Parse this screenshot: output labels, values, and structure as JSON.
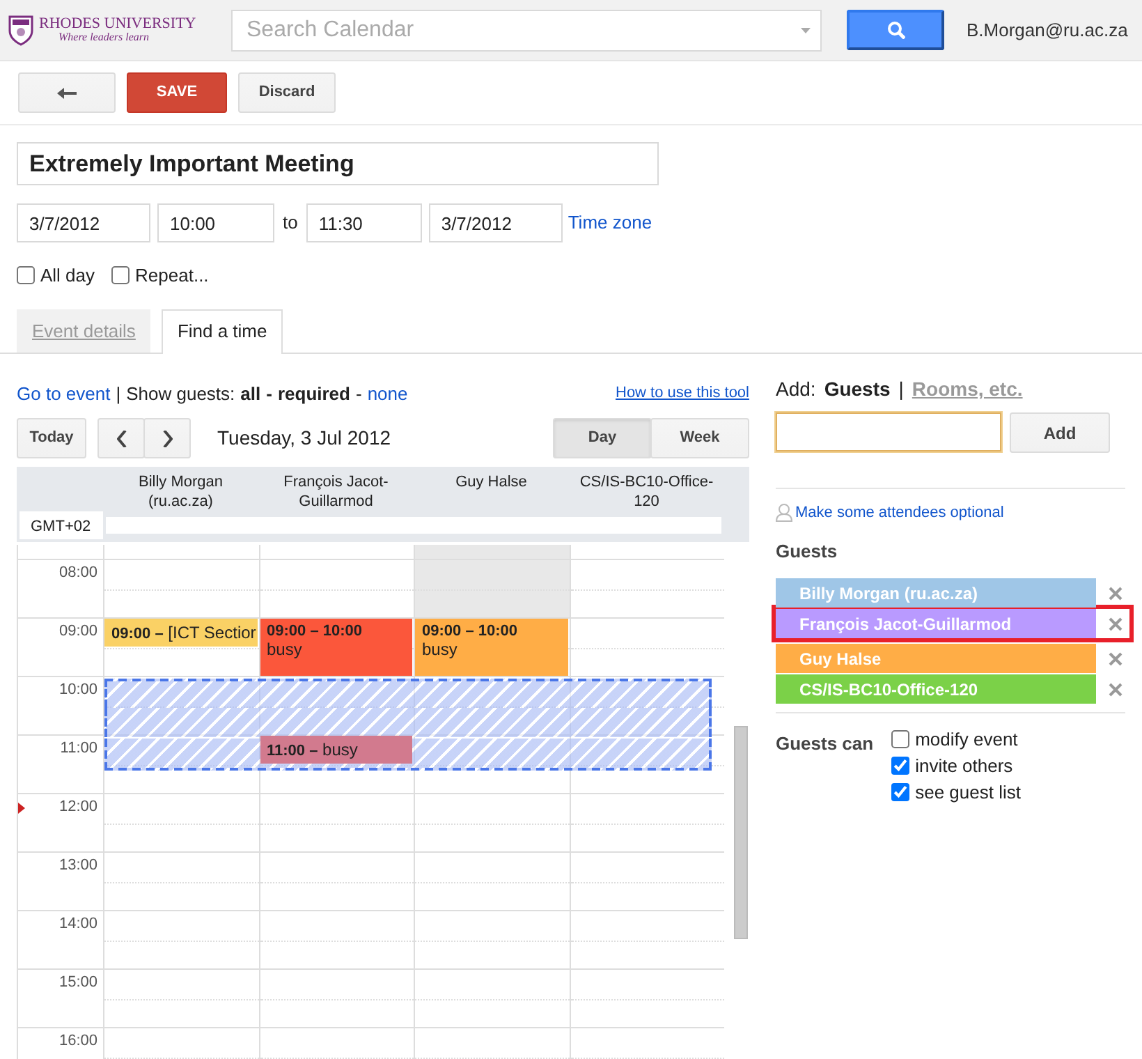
{
  "header": {
    "logo": {
      "name": "RHODES UNIVERSITY",
      "tagline": "Where leaders learn"
    },
    "search": {
      "placeholder": "Search Calendar"
    },
    "user": "B.Morgan@ru.ac.za"
  },
  "toolbar": {
    "save": "SAVE",
    "discard": "Discard"
  },
  "event": {
    "title": "Extremely Important Meeting",
    "start_date": "3/7/2012",
    "start_time": "10:00",
    "to": "to",
    "end_time": "11:30",
    "end_date": "3/7/2012",
    "time_zone": "Time zone"
  },
  "options": [
    {
      "label": "All day",
      "checked": false
    },
    {
      "label": "Repeat...",
      "checked": false
    }
  ],
  "tabs": [
    {
      "label": "Event details",
      "selected": false
    },
    {
      "label": "Find a time",
      "selected": true
    }
  ],
  "find_time": {
    "go_to_event": "Go to event",
    "separator": "|",
    "show_guests_label": "Show guests:",
    "filter_separator": "-",
    "filters": [
      {
        "label": "all",
        "selected": true
      },
      {
        "label": "required",
        "selected": true
      },
      {
        "label": "none",
        "selected": false
      }
    ],
    "help_link": "How to use this tool",
    "today": "Today",
    "date": "Tuesday, 3 Jul 2012",
    "views": [
      {
        "label": "Day",
        "selected": true
      },
      {
        "label": "Week",
        "selected": false
      }
    ],
    "timezone": "GMT+02",
    "columns": [
      "Billy Morgan (ru.ac.za)",
      "François Jacot-Guillarmod",
      "Guy Halse",
      "CS/IS-BC10-Office-120"
    ],
    "hours": [
      {
        "kind": "partial",
        "now": false,
        "halves": [
          {
            "selected": false
          }
        ],
        "cells": [
          {
            "kind": "free"
          },
          {
            "kind": "free"
          },
          {
            "kind": "shaded"
          },
          {
            "kind": "free"
          }
        ]
      },
      {
        "kind": "hour",
        "label": "08:00",
        "now": false,
        "halves": [
          {
            "selected": false
          },
          {
            "selected": false
          }
        ],
        "cells": [
          {
            "kind": "free"
          },
          {
            "kind": "free"
          },
          {
            "kind": "shaded"
          },
          {
            "kind": "free"
          }
        ]
      },
      {
        "kind": "hour",
        "label": "09:00",
        "now": false,
        "halves": [
          {
            "selected": false
          },
          {
            "selected": false
          }
        ],
        "cells": [
          {
            "kind": "brief",
            "color": "#fad165",
            "time": "09:00 –",
            "text": "[ICT Sectior"
          },
          {
            "kind": "block",
            "color": "#fb573b",
            "time": "09:00 – 10:00",
            "text": "busy"
          },
          {
            "kind": "block",
            "color": "#ffad46",
            "time": "09:00 – 10:00",
            "text": "busy"
          },
          {
            "kind": "free"
          }
        ]
      },
      {
        "kind": "hour",
        "label": "10:00",
        "now": false,
        "halves": [
          {
            "selected": true
          },
          {
            "selected": true
          }
        ],
        "cells": [
          {
            "kind": "free"
          },
          {
            "kind": "free"
          },
          {
            "kind": "free"
          },
          {
            "kind": "free"
          }
        ]
      },
      {
        "kind": "hour",
        "label": "11:00",
        "now": false,
        "halves": [
          {
            "selected": true
          },
          {
            "selected": false
          }
        ],
        "cells": [
          {
            "kind": "free"
          },
          {
            "kind": "brief",
            "color": "#d27a8e",
            "time": "11:00 –",
            "text": "busy"
          },
          {
            "kind": "free"
          },
          {
            "kind": "free"
          }
        ]
      },
      {
        "kind": "hour",
        "label": "12:00",
        "now": true,
        "halves": [
          {
            "selected": false
          },
          {
            "selected": false
          }
        ],
        "cells": [
          {
            "kind": "free"
          },
          {
            "kind": "free"
          },
          {
            "kind": "free"
          },
          {
            "kind": "free"
          }
        ]
      },
      {
        "kind": "hour",
        "label": "13:00",
        "now": false,
        "halves": [
          {
            "selected": false
          },
          {
            "selected": false
          }
        ],
        "cells": [
          {
            "kind": "free"
          },
          {
            "kind": "free"
          },
          {
            "kind": "free"
          },
          {
            "kind": "free"
          }
        ]
      },
      {
        "kind": "hour",
        "label": "14:00",
        "now": false,
        "halves": [
          {
            "selected": false
          },
          {
            "selected": false
          }
        ],
        "cells": [
          {
            "kind": "free"
          },
          {
            "kind": "free"
          },
          {
            "kind": "free"
          },
          {
            "kind": "free"
          }
        ]
      },
      {
        "kind": "hour",
        "label": "15:00",
        "now": false,
        "halves": [
          {
            "selected": false
          },
          {
            "selected": false
          }
        ],
        "cells": [
          {
            "kind": "free"
          },
          {
            "kind": "free"
          },
          {
            "kind": "free"
          },
          {
            "kind": "free"
          }
        ]
      },
      {
        "kind": "hour",
        "label": "16:00",
        "now": false,
        "halves": [
          {
            "selected": false
          },
          {
            "selected": false
          }
        ],
        "cells": [
          {
            "kind": "free"
          },
          {
            "kind": "free"
          },
          {
            "kind": "free"
          },
          {
            "kind": "free"
          }
        ]
      }
    ]
  },
  "guests_panel": {
    "add_label": "Add:",
    "add_separator": "|",
    "add_tabs": [
      {
        "label": "Guests",
        "selected": true
      },
      {
        "label": "Rooms, etc.",
        "selected": false
      }
    ],
    "guest_input": {
      "focused": true
    },
    "add_button": "Add",
    "optional_link": "Make some attendees optional",
    "guests_heading": "Guests",
    "guests": [
      {
        "name": "Billy Morgan (ru.ac.za)",
        "color": "#9fc6e7",
        "highlighted": false
      },
      {
        "name": "François Jacot-Guillarmod",
        "color": "#b99aff",
        "highlighted": true
      },
      {
        "name": "Guy Halse",
        "color": "#ffad46",
        "highlighted": false
      },
      {
        "name": "CS/IS-BC10-Office-120",
        "color": "#7bd148",
        "highlighted": false
      }
    ],
    "guests_can_label": "Guests can",
    "permissions": [
      {
        "label": "modify event",
        "checked": false
      },
      {
        "label": "invite others",
        "checked": true
      },
      {
        "label": "see guest list",
        "checked": true
      }
    ]
  }
}
